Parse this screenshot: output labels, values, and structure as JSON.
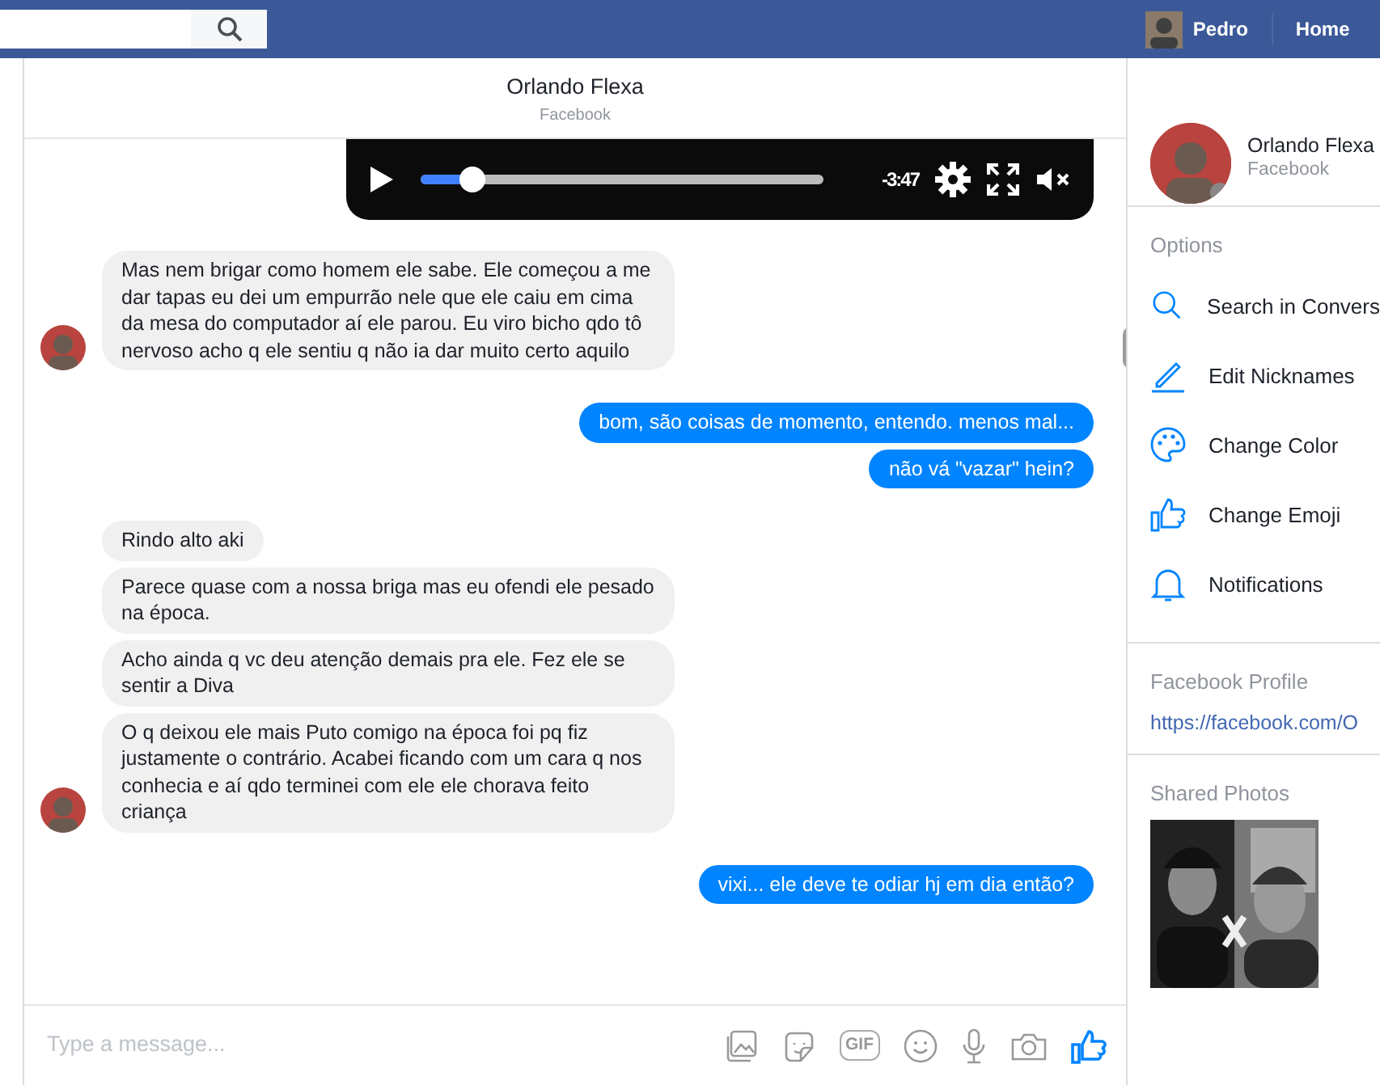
{
  "topbar": {
    "user": "Pedro",
    "home": "Home"
  },
  "conversation": {
    "title": "Orlando Flexa",
    "subtitle": "Facebook"
  },
  "player": {
    "level": 0.13,
    "time": "-3:47",
    "muted": true
  },
  "messages": [
    {
      "kind": "received",
      "avatar": true,
      "text": "Mas nem brigar como homem ele sabe. Ele começou a me dar tapas eu dei um empurrão nele que ele caiu em cima da mesa do computador aí ele parou. Eu viro bicho qdo tô nervoso acho q ele sentiu q não ia dar muito certo aquilo"
    },
    {
      "kind": "sent",
      "text": "bom, são coisas de momento, entendo. menos mal..."
    },
    {
      "kind": "sent",
      "text": "não vá \"vazar\" hein?"
    },
    {
      "kind": "received",
      "avatar": false,
      "text": "Rindo alto aki"
    },
    {
      "kind": "received",
      "avatar": false,
      "text": "Parece quase com a nossa briga mas eu ofendi ele pesado na época."
    },
    {
      "kind": "received",
      "avatar": false,
      "text": "Acho ainda q vc deu atenção demais pra ele. Fez ele se sentir a Diva"
    },
    {
      "kind": "received",
      "avatar": true,
      "text": "O q deixou ele mais Puto comigo na época foi pq fiz justamente o contrário.  Acabei ficando com um cara q nos conhecia e aí qdo terminei com ele ele chorava feito criança"
    },
    {
      "kind": "sent",
      "text": "vixi... ele deve te odiar hj em dia então?"
    }
  ],
  "composer": {
    "placeholder": "Type a message...",
    "gif": "GIF"
  },
  "panel": {
    "name": "Orlando Flexa",
    "subtitle": "Facebook",
    "options_title": "Options",
    "options": [
      {
        "kind": "search",
        "label": "Search in Convers"
      },
      {
        "kind": "edit",
        "label": "Edit Nicknames"
      },
      {
        "kind": "color",
        "label": "Change Color"
      },
      {
        "kind": "emoji",
        "label": "Change Emoji"
      },
      {
        "kind": "bell",
        "label": "Notifications"
      }
    ],
    "profile_title": "Facebook Profile",
    "profile_link": "https://facebook.com/O",
    "photos_title": "Shared Photos"
  }
}
